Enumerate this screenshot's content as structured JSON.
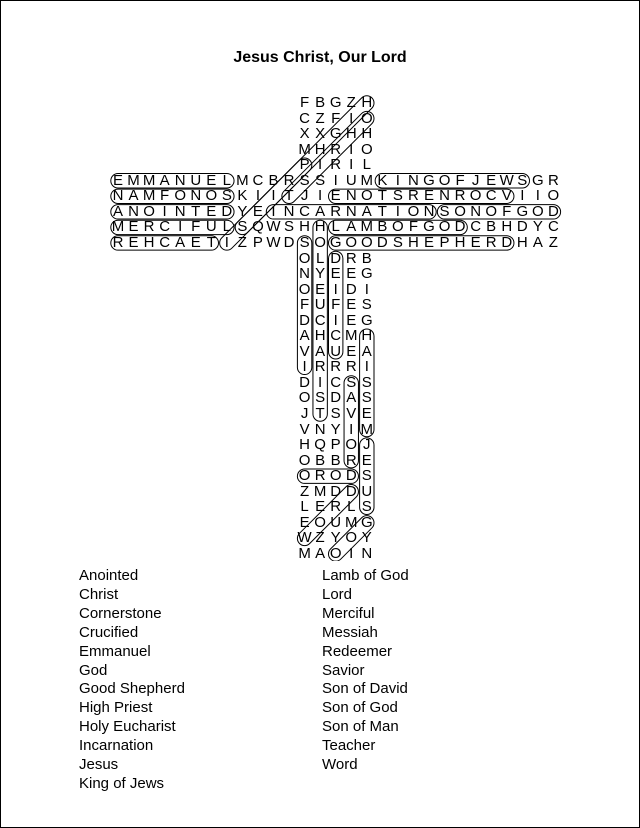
{
  "title": "Jesus Christ, Our Lord",
  "grid": {
    "top_rows": [
      "FBGZH",
      "CZFIO",
      "XXGHH",
      "MHRIO",
      "PIRIL"
    ],
    "middle_rows": [
      "EMMANUELMCBRSSIUMKINGOFJEWSGR",
      "NAMFONOSKIITJIENOTSRENROCVIIO",
      "ANOINTEDYEINCARNATIONSONOFGOD",
      "MERCIFULSQWSHHLAMBOFGODCBHDYC",
      "REHCAETIZPWDSOGOODSHEPHERDHAZ"
    ],
    "bottom_rows": [
      "OLDRB",
      "NYEEG",
      "OEIDI",
      "FUFES",
      "DCIEG",
      "AHCMH",
      "VAUEA",
      "IRRRI",
      "DICSS",
      "OSDAS",
      "JTSVE",
      "VNYIM",
      "HQPOJ",
      "OBBRE",
      "ORODS",
      "ZMDDU",
      "LERLS",
      "EOUMG",
      "WZYOY",
      "MAOIN"
    ],
    "vertical_block_col": 12
  },
  "found_words": [
    {
      "word": "EMMANUEL",
      "r1": 5,
      "c1": 0,
      "r2": 5,
      "c2": 7
    },
    {
      "word": "KING OF JEWS",
      "r1": 5,
      "c1": 17,
      "r2": 5,
      "c2": 26
    },
    {
      "word": "SON OF MAN",
      "r1": 6,
      "c1": 7,
      "r2": 6,
      "c2": 0
    },
    {
      "word": "CORNERSTONE",
      "r1": 6,
      "c1": 25,
      "r2": 6,
      "c2": 14
    },
    {
      "word": "ANOINTED",
      "r1": 7,
      "c1": 0,
      "r2": 7,
      "c2": 7
    },
    {
      "word": "INCARNATION",
      "r1": 7,
      "c1": 10,
      "r2": 7,
      "c2": 20
    },
    {
      "word": "SON OF GOD",
      "r1": 7,
      "c1": 21,
      "r2": 7,
      "c2": 28
    },
    {
      "word": "MERCIFUL",
      "r1": 8,
      "c1": 0,
      "r2": 8,
      "c2": 7
    },
    {
      "word": "LAMB OF GOD",
      "r1": 8,
      "c1": 14,
      "r2": 8,
      "c2": 22
    },
    {
      "word": "TEACHER",
      "r1": 9,
      "c1": 6,
      "r2": 9,
      "c2": 0
    },
    {
      "word": "GOOD SHEPHERD",
      "r1": 9,
      "c1": 14,
      "r2": 9,
      "c2": 25
    },
    {
      "word": "HIGH PRIEST",
      "r1": 0,
      "c1": 16,
      "r2": 9,
      "c2": 7
    },
    {
      "word": "CHRIST",
      "r1": 1,
      "c1": 16,
      "r2": 6,
      "c2": 11
    },
    {
      "word": "CRUCIFIED",
      "r1": 4,
      "c1": 12,
      "r2": 8,
      "c2": 8
    },
    {
      "word": "SON OF DAVID",
      "r1": 9,
      "c1": 12,
      "r2": 17,
      "c2": 12
    },
    {
      "word": "HOLY EUCHARIST",
      "r1": 8,
      "c1": 13,
      "r2": 20,
      "c2": 13
    },
    {
      "word": "REDEEMER",
      "r1": 10,
      "c1": 14,
      "r2": 16,
      "c2": 14
    },
    {
      "word": "SAVIOR",
      "r1": 18,
      "c1": 15,
      "r2": 23,
      "c2": 15
    },
    {
      "word": "MESSIAH",
      "r1": 15,
      "c1": 16,
      "r2": 21,
      "c2": 16
    },
    {
      "word": "JESUS",
      "r1": 22,
      "c1": 16,
      "r2": 26,
      "c2": 16
    },
    {
      "word": "LORD",
      "r1": 24,
      "c1": 12,
      "r2": 24,
      "c2": 15
    },
    {
      "word": "GOD",
      "r1": 27,
      "c1": 16,
      "r2": 29,
      "c2": 14
    },
    {
      "word": "WORD",
      "r1": 28,
      "c1": 12,
      "r2": 25,
      "c2": 15
    }
  ],
  "word_list": {
    "left": [
      "Anointed",
      "Christ",
      "Cornerstone",
      "Crucified",
      "Emmanuel",
      "God",
      "Good Shepherd",
      "High Priest",
      "Holy Eucharist",
      "Incarnation",
      "Jesus",
      "King of Jews"
    ],
    "right": [
      "Lamb of God",
      "Lord",
      "Merciful",
      "Messiah",
      "Redeemer",
      "Savior",
      "Son of David",
      "Son of God",
      "Son of Man",
      "Teacher",
      "Word"
    ]
  }
}
